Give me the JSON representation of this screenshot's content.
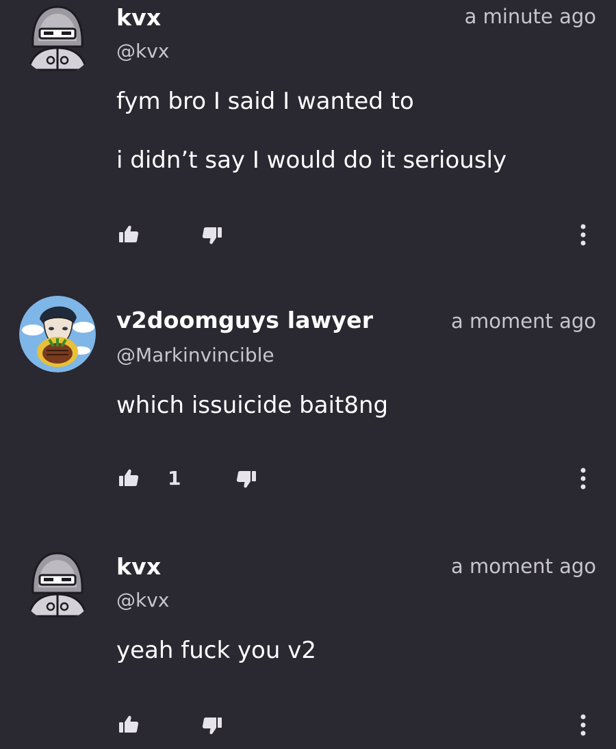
{
  "comments": [
    {
      "author": "kvx",
      "handle": "@kvx",
      "time": "a minute ago",
      "avatar_icon": "hooded-ninja-avatar",
      "paragraphs": [
        "fym bro I said I wanted to",
        "i didn’t say I would do it seriously"
      ],
      "likes": null
    },
    {
      "author": "v2doomguys lawyer",
      "handle": "@Markinvincible",
      "time": "a moment ago",
      "avatar_icon": "anime-character-avatar",
      "paragraphs": [
        "which issuicide bait8ng"
      ],
      "likes": "1"
    },
    {
      "author": "kvx",
      "handle": "@kvx",
      "time": "a moment ago",
      "avatar_icon": "hooded-ninja-avatar",
      "paragraphs": [
        "yeah fuck you v2"
      ],
      "likes": null
    }
  ],
  "colors": {
    "background": "#2a2830",
    "text": "#ffffff",
    "muted": "#c8c6cc",
    "icon": "#e6e4ea"
  }
}
